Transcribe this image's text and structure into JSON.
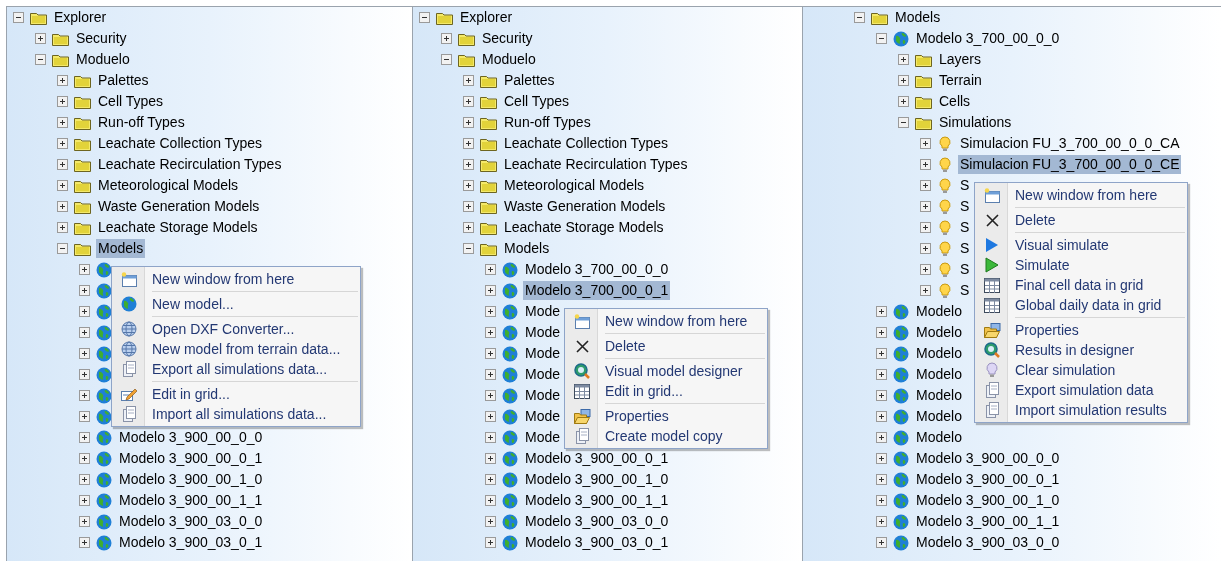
{
  "panels": [
    {
      "tree": [
        {
          "kind": "folder",
          "label": "Explorer",
          "expanded": true,
          "selected": false,
          "children": [
            {
              "kind": "folder",
              "label": "Security",
              "expanded": false,
              "selected": false
            },
            {
              "kind": "folder",
              "label": "Moduelo",
              "expanded": true,
              "selected": false,
              "children": [
                {
                  "kind": "folder",
                  "label": "Palettes",
                  "expanded": false,
                  "selected": false
                },
                {
                  "kind": "folder",
                  "label": "Cell Types",
                  "expanded": false,
                  "selected": false
                },
                {
                  "kind": "folder",
                  "label": "Run-off Types",
                  "expanded": false,
                  "selected": false
                },
                {
                  "kind": "folder",
                  "label": "Leachate Collection Types",
                  "expanded": false,
                  "selected": false
                },
                {
                  "kind": "folder",
                  "label": "Leachate Recirculation Types",
                  "expanded": false,
                  "selected": false
                },
                {
                  "kind": "folder",
                  "label": "Meteorological Models",
                  "expanded": false,
                  "selected": false
                },
                {
                  "kind": "folder",
                  "label": "Waste Generation Models",
                  "expanded": false,
                  "selected": false
                },
                {
                  "kind": "folder",
                  "label": "Leachate Storage Models",
                  "expanded": false,
                  "selected": false
                },
                {
                  "kind": "folder",
                  "label": "Models",
                  "expanded": true,
                  "selected": true,
                  "children": [
                    {
                      "kind": "model",
                      "expanded": false,
                      "selected": false
                    },
                    {
                      "kind": "model",
                      "expanded": false,
                      "selected": false
                    },
                    {
                      "kind": "model",
                      "expanded": false,
                      "selected": false
                    },
                    {
                      "kind": "model",
                      "expanded": false,
                      "selected": false
                    },
                    {
                      "kind": "model",
                      "expanded": false,
                      "selected": false
                    },
                    {
                      "kind": "model",
                      "expanded": false,
                      "selected": false
                    },
                    {
                      "kind": "model",
                      "expanded": false,
                      "selected": false
                    },
                    {
                      "kind": "model",
                      "expanded": false,
                      "selected": false
                    },
                    {
                      "kind": "model",
                      "label": "Modelo 3_900_00_0_0",
                      "expanded": false,
                      "selected": false
                    },
                    {
                      "kind": "model",
                      "label": "Modelo 3_900_00_0_1",
                      "expanded": false,
                      "selected": false
                    },
                    {
                      "kind": "model",
                      "label": "Modelo 3_900_00_1_0",
                      "expanded": false,
                      "selected": false
                    },
                    {
                      "kind": "model",
                      "label": "Modelo 3_900_00_1_1",
                      "expanded": false,
                      "selected": false
                    },
                    {
                      "kind": "model",
                      "label": "Modelo 3_900_03_0_0",
                      "expanded": false,
                      "selected": false
                    },
                    {
                      "kind": "model",
                      "label": "Modelo 3_900_03_0_1",
                      "expanded": false,
                      "selected": false
                    }
                  ]
                }
              ]
            }
          ]
        }
      ],
      "context_menu": {
        "groups": [
          [
            {
              "kind": "window",
              "label": "New window from here"
            }
          ],
          [
            {
              "kind": "globe",
              "label": "New model..."
            }
          ],
          [
            {
              "kind": "web",
              "label": "Open DXF Converter..."
            },
            {
              "kind": "web",
              "label": "New model from terrain data..."
            },
            {
              "kind": "document",
              "label": "Export all simulations data..."
            }
          ],
          [
            {
              "kind": "edit",
              "label": "Edit in grid..."
            },
            {
              "kind": "document",
              "label": "Import all simulations data..."
            }
          ]
        ]
      }
    },
    {
      "tree": [
        {
          "kind": "folder",
          "label": "Explorer",
          "expanded": true,
          "selected": false,
          "children": [
            {
              "kind": "folder",
              "label": "Security",
              "expanded": false,
              "selected": false
            },
            {
              "kind": "folder",
              "label": "Moduelo",
              "expanded": true,
              "selected": false,
              "children": [
                {
                  "kind": "folder",
                  "label": "Palettes",
                  "expanded": false,
                  "selected": false
                },
                {
                  "kind": "folder",
                  "label": "Cell Types",
                  "expanded": false,
                  "selected": false
                },
                {
                  "kind": "folder",
                  "label": "Run-off Types",
                  "expanded": false,
                  "selected": false
                },
                {
                  "kind": "folder",
                  "label": "Leachate Collection Types",
                  "expanded": false,
                  "selected": false
                },
                {
                  "kind": "folder",
                  "label": "Leachate Recirculation Types",
                  "expanded": false,
                  "selected": false
                },
                {
                  "kind": "folder",
                  "label": "Meteorological Models",
                  "expanded": false,
                  "selected": false
                },
                {
                  "kind": "folder",
                  "label": "Waste Generation Models",
                  "expanded": false,
                  "selected": false
                },
                {
                  "kind": "folder",
                  "label": "Leachate Storage Models",
                  "expanded": false,
                  "selected": false
                },
                {
                  "kind": "folder",
                  "label": "Models",
                  "expanded": true,
                  "selected": false,
                  "children": [
                    {
                      "kind": "model",
                      "label": "Modelo 3_700_00_0_0",
                      "expanded": false,
                      "selected": false
                    },
                    {
                      "kind": "model",
                      "label": "Modelo 3_700_00_0_1",
                      "expanded": false,
                      "selected": true
                    },
                    {
                      "kind": "model",
                      "label": "Mode",
                      "expanded": false,
                      "selected": false
                    },
                    {
                      "kind": "model",
                      "label": "Mode",
                      "expanded": false,
                      "selected": false
                    },
                    {
                      "kind": "model",
                      "label": "Mode",
                      "expanded": false,
                      "selected": false
                    },
                    {
                      "kind": "model",
                      "label": "Mode",
                      "expanded": false,
                      "selected": false
                    },
                    {
                      "kind": "model",
                      "label": "Mode",
                      "expanded": false,
                      "selected": false
                    },
                    {
                      "kind": "model",
                      "label": "Mode",
                      "expanded": false,
                      "selected": false
                    },
                    {
                      "kind": "model",
                      "label": "Mode",
                      "expanded": false,
                      "selected": false
                    },
                    {
                      "kind": "model",
                      "label": "Modelo 3_900_00_0_1",
                      "expanded": false,
                      "selected": false
                    },
                    {
                      "kind": "model",
                      "label": "Modelo 3_900_00_1_0",
                      "expanded": false,
                      "selected": false
                    },
                    {
                      "kind": "model",
                      "label": "Modelo 3_900_00_1_1",
                      "expanded": false,
                      "selected": false
                    },
                    {
                      "kind": "model",
                      "label": "Modelo 3_900_03_0_0",
                      "expanded": false,
                      "selected": false
                    },
                    {
                      "kind": "model",
                      "label": "Modelo 3_900_03_0_1",
                      "expanded": false,
                      "selected": false
                    }
                  ]
                }
              ]
            }
          ]
        }
      ],
      "context_menu": {
        "groups": [
          [
            {
              "kind": "window",
              "label": "New window from here"
            }
          ],
          [
            {
              "kind": "delete",
              "label": "Delete"
            }
          ],
          [
            {
              "kind": "designer",
              "label": "Visual model designer"
            },
            {
              "kind": "grid",
              "label": "Edit in grid..."
            }
          ],
          [
            {
              "kind": "folder",
              "label": "Properties"
            },
            {
              "kind": "document",
              "label": "Create model copy"
            }
          ]
        ]
      }
    },
    {
      "tree": [
        {
          "kind": "folder",
          "label": "Models",
          "expanded": true,
          "selected": false,
          "children": [
            {
              "kind": "model",
              "label": "Modelo 3_700_00_0_0",
              "expanded": true,
              "selected": false,
              "children": [
                {
                  "kind": "folder",
                  "label": "Layers",
                  "expanded": false,
                  "selected": false
                },
                {
                  "kind": "folder",
                  "label": "Terrain",
                  "expanded": false,
                  "selected": false
                },
                {
                  "kind": "folder",
                  "label": "Cells",
                  "expanded": false,
                  "selected": false
                },
                {
                  "kind": "folder",
                  "label": "Simulations",
                  "expanded": true,
                  "selected": false,
                  "children": [
                    {
                      "kind": "simulation",
                      "label": "Simulacion FU_3_700_00_0_0_CA",
                      "expanded": false,
                      "selected": false
                    },
                    {
                      "kind": "simulation",
                      "label": "Simulacion FU_3_700_00_0_0_CE",
                      "expanded": false,
                      "selected": true
                    },
                    {
                      "kind": "simulation",
                      "label": "S",
                      "expanded": false,
                      "selected": false
                    },
                    {
                      "kind": "simulation",
                      "label": "S",
                      "expanded": false,
                      "selected": false
                    },
                    {
                      "kind": "simulation",
                      "label": "S",
                      "expanded": false,
                      "selected": false
                    },
                    {
                      "kind": "simulation",
                      "label": "S",
                      "expanded": false,
                      "selected": false
                    },
                    {
                      "kind": "simulation",
                      "label": "S",
                      "expanded": false,
                      "selected": false
                    },
                    {
                      "kind": "simulation",
                      "label": "S",
                      "expanded": false,
                      "selected": false
                    }
                  ]
                }
              ]
            },
            {
              "kind": "model",
              "label": "Modelo",
              "expanded": false,
              "selected": false
            },
            {
              "kind": "model",
              "label": "Modelo",
              "expanded": false,
              "selected": false
            },
            {
              "kind": "model",
              "label": "Modelo",
              "expanded": false,
              "selected": false
            },
            {
              "kind": "model",
              "label": "Modelo",
              "expanded": false,
              "selected": false
            },
            {
              "kind": "model",
              "label": "Modelo",
              "expanded": false,
              "selected": false
            },
            {
              "kind": "model",
              "label": "Modelo",
              "expanded": false,
              "selected": false
            },
            {
              "kind": "model",
              "label": "Modelo",
              "expanded": false,
              "selected": false
            },
            {
              "kind": "model",
              "label": "Modelo 3_900_00_0_0",
              "expanded": false,
              "selected": false
            },
            {
              "kind": "model",
              "label": "Modelo 3_900_00_0_1",
              "expanded": false,
              "selected": false
            },
            {
              "kind": "model",
              "label": "Modelo 3_900_00_1_0",
              "expanded": false,
              "selected": false
            },
            {
              "kind": "model",
              "label": "Modelo 3_900_00_1_1",
              "expanded": false,
              "selected": false
            },
            {
              "kind": "model",
              "label": "Modelo 3_900_03_0_0",
              "expanded": false,
              "selected": false
            }
          ]
        }
      ],
      "context_menu": {
        "groups": [
          [
            {
              "kind": "window",
              "label": "New window from here"
            }
          ],
          [
            {
              "kind": "delete",
              "label": "Delete"
            }
          ],
          [
            {
              "kind": "visual",
              "label": "Visual simulate"
            },
            {
              "kind": "play",
              "label": "Simulate"
            },
            {
              "kind": "grid",
              "label": "Final cell data in grid"
            },
            {
              "kind": "grid",
              "label": "Global daily data in grid"
            }
          ],
          [
            {
              "kind": "folder",
              "label": "Properties"
            },
            {
              "kind": "designer",
              "label": "Results in designer"
            },
            {
              "kind": "bulb",
              "label": "Clear simulation"
            },
            {
              "kind": "document",
              "label": "Export simulation data"
            },
            {
              "kind": "document",
              "label": "Import simulation results"
            }
          ]
        ]
      }
    }
  ]
}
